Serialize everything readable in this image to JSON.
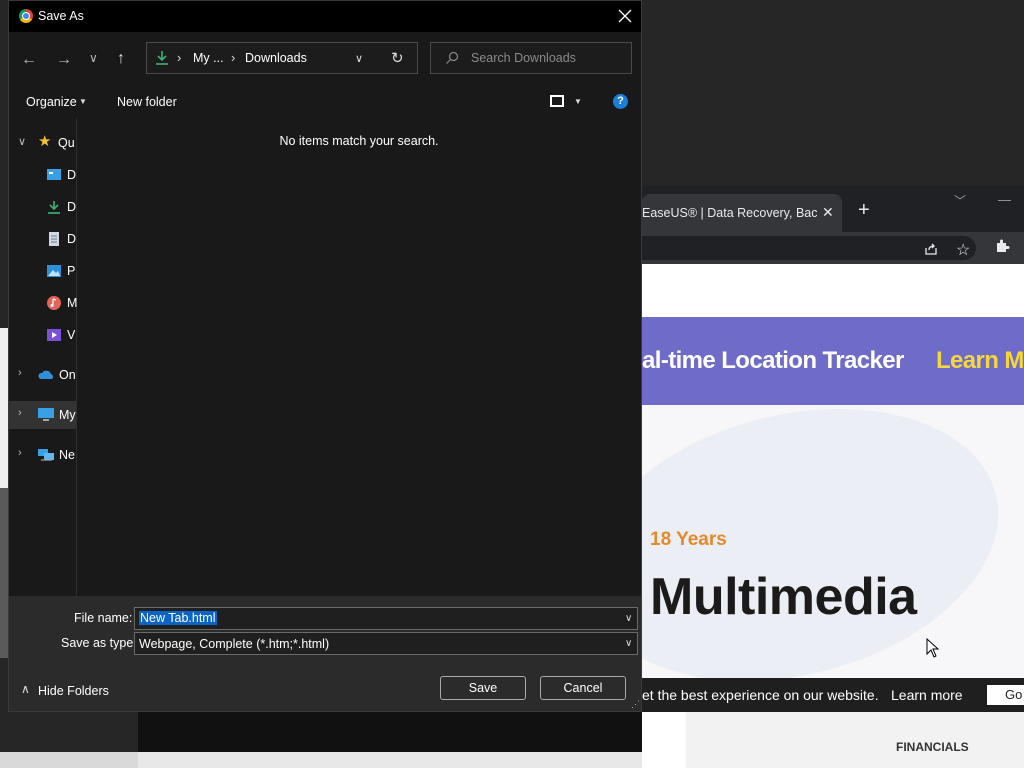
{
  "dialog": {
    "title": "Save As",
    "nav": {
      "path": [
        "My ...",
        "Downloads"
      ],
      "search_placeholder": "Search Downloads"
    },
    "commands": {
      "organize": "Organize",
      "new_folder": "New folder"
    },
    "sidebar": [
      {
        "label": "Qu",
        "icon": "star-icon",
        "expand": "expanded"
      },
      {
        "label": "D",
        "icon": "desktop-icon"
      },
      {
        "label": "D",
        "icon": "download-icon"
      },
      {
        "label": "D",
        "icon": "document-icon"
      },
      {
        "label": "P",
        "icon": "pictures-icon"
      },
      {
        "label": "M",
        "icon": "music-icon"
      },
      {
        "label": "V",
        "icon": "videos-icon"
      },
      {
        "label": "On",
        "icon": "onedrive-icon",
        "expand": "collapsed"
      },
      {
        "label": "My",
        "icon": "this-pc-icon",
        "expand": "collapsed"
      },
      {
        "label": "Ne",
        "icon": "network-icon",
        "expand": "collapsed"
      }
    ],
    "empty_message": "No items match your search.",
    "file_name_label": "File name:",
    "file_name_value": "New Tab.html",
    "save_type_label": "Save as type:",
    "save_type_value": "Webpage, Complete (*.htm;*.html)",
    "hide_folders": "Hide Folders",
    "save_button": "Save",
    "cancel_button": "Cancel"
  },
  "browser": {
    "tab_title": "EaseUS® | Data Recovery, Backup",
    "banner_text": "al-time Location Tracker",
    "banner_link": "Learn Mo",
    "years_text": "18 Years",
    "headline": "Multimedia",
    "cookie_text": "et the best experience on our website.",
    "cookie_link": "Learn more",
    "cookie_button": "Go",
    "footer_word": "FINANCIALS"
  },
  "colors": {
    "accent": "#0a64c8",
    "banner": "#6f6cc9",
    "banner_link": "#f5d63c",
    "years": "#e58a2c",
    "help": "#1a7fd6",
    "download_icon": "#3cb371"
  }
}
